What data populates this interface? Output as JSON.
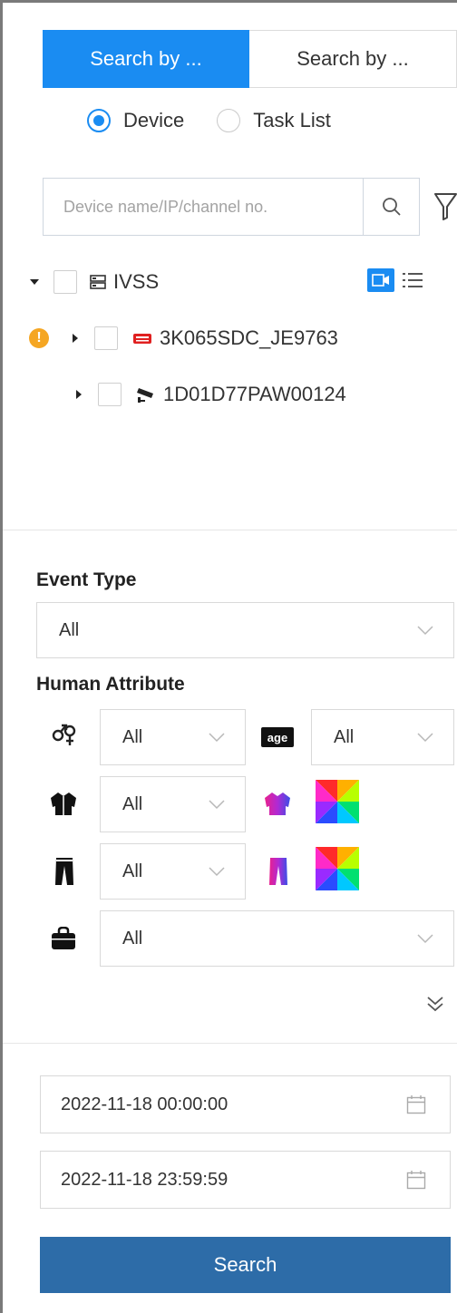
{
  "tabs": [
    {
      "label": "Search by ...",
      "active": true
    },
    {
      "label": "Search by ...",
      "active": false
    }
  ],
  "radios": [
    {
      "label": "Device",
      "checked": true
    },
    {
      "label": "Task List",
      "checked": false
    }
  ],
  "search": {
    "placeholder": "Device name/IP/channel no."
  },
  "tree": {
    "root": {
      "label": "IVSS",
      "icon": "server-icon"
    },
    "children": [
      {
        "label": "3K065SDC_JE9763",
        "icon": "nvr-device-icon",
        "warning": "!"
      },
      {
        "label": "1D01D77PAW00124",
        "icon": "camera-icon"
      }
    ]
  },
  "event_type": {
    "title": "Event Type",
    "value": "All"
  },
  "human_attribute": {
    "title": "Human Attribute",
    "gender": "All",
    "age_icon_text": "age",
    "age": "All",
    "top": "All",
    "bottom": "All",
    "bag": "All"
  },
  "dates": {
    "start": "2022-11-18 00:00:00",
    "end": "2022-11-18 23:59:59"
  },
  "search_button": "Search",
  "colors": {
    "accent": "#1a8cf2",
    "button": "#2d6ca8",
    "warning": "#f5a623",
    "device_red": "#e02020"
  }
}
